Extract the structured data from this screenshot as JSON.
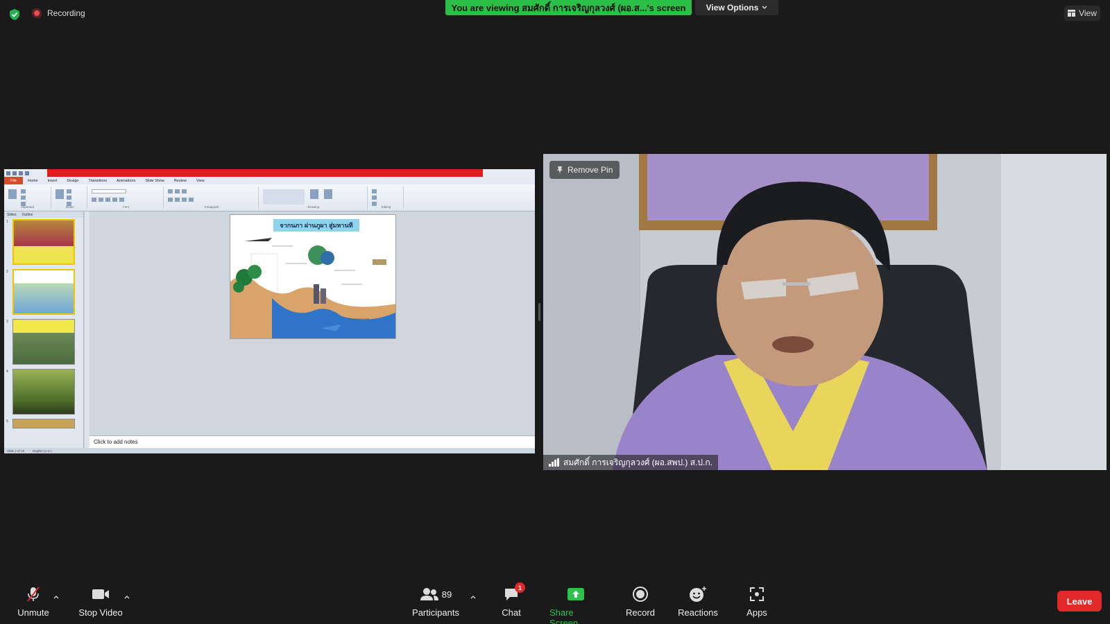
{
  "top": {
    "recording_label": "Recording",
    "viewing_banner": "You are viewing สมศักดิ์ การเจริญกุลวงศ์ (ผอ.ส...'s screen",
    "view_options_label": "View Options",
    "view_label": "View"
  },
  "shared_screen": {
    "app": "Microsoft PowerPoint",
    "menu_tabs": [
      "File",
      "Home",
      "Insert",
      "Design",
      "Transitions",
      "Animations",
      "Slide Show",
      "Review",
      "View"
    ],
    "ribbon_groups": [
      "Clipboard",
      "Slides",
      "Font",
      "Paragraph",
      "Drawing",
      "Editing"
    ],
    "pane_tabs": [
      "Slides",
      "Outline"
    ],
    "slide_title": "จากนภา ผ่านภูผา สู่มหานที",
    "notes_placeholder": "Click to add notes",
    "status_slide": "Slide 2 of 15",
    "status_language": "English (U.S.)"
  },
  "video": {
    "remove_pin_label": "Remove Pin",
    "participant_name": "สมศักดิ์ การเจริญกุลวงศ์ (ผอ.สพป.) ส.ป.ก."
  },
  "toolbar": {
    "unmute_label": "Unmute",
    "stop_video_label": "Stop Video",
    "participants_label": "Participants",
    "participants_count": "89",
    "chat_label": "Chat",
    "chat_badge": "1",
    "share_screen_label": "Share Screen",
    "record_label": "Record",
    "reactions_label": "Reactions",
    "apps_label": "Apps",
    "leave_label": "Leave"
  },
  "colors": {
    "banner_green": "#2cbf47",
    "leave_red": "#e02828",
    "record_dot": "#f0484f"
  }
}
